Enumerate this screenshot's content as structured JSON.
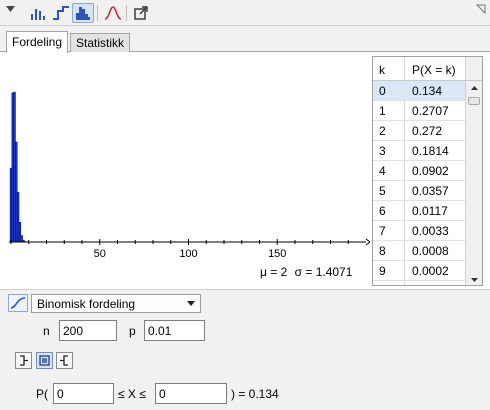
{
  "toolbar": {
    "buttons": [
      {
        "name": "bar-chart-icon"
      },
      {
        "name": "step-graph-icon"
      },
      {
        "name": "histogram-icon",
        "active": true
      },
      {
        "name": "normal-overlay-icon"
      },
      {
        "name": "export-icon"
      }
    ]
  },
  "tabs": [
    {
      "label": "Fordeling",
      "active": true
    },
    {
      "label": "Statistikk",
      "active": false
    }
  ],
  "chart_data": {
    "type": "bar",
    "x": [
      0,
      1,
      2,
      3,
      4,
      5,
      6,
      7,
      8,
      9
    ],
    "values": [
      0.134,
      0.2707,
      0.272,
      0.1814,
      0.0902,
      0.0357,
      0.0117,
      0.0033,
      0.0008,
      0.0002
    ],
    "xlim": [
      0,
      200
    ],
    "xticks": [
      "50",
      "100",
      "150"
    ],
    "ylim": [
      0,
      0.285
    ],
    "color": "#1f3bd1",
    "edge_color": "#0a0a6e",
    "grid": false
  },
  "stats": {
    "mu": "μ = 2",
    "sigma": "σ = 1.4071"
  },
  "table": {
    "headers": [
      "k",
      "P(X = k)"
    ],
    "rows": [
      {
        "k": "0",
        "p": "0.134",
        "selected": true
      },
      {
        "k": "1",
        "p": "0.2707"
      },
      {
        "k": "2",
        "p": "0.272"
      },
      {
        "k": "3",
        "p": "0.1814"
      },
      {
        "k": "4",
        "p": "0.0902"
      },
      {
        "k": "5",
        "p": "0.0357"
      },
      {
        "k": "6",
        "p": "0.0117"
      },
      {
        "k": "7",
        "p": "0.0033"
      },
      {
        "k": "8",
        "p": "0.0008"
      },
      {
        "k": "9",
        "p": "0.0002"
      }
    ]
  },
  "distribution": {
    "selected": "Binomisk fordeling"
  },
  "params": {
    "n_label": "n",
    "n_value": "200",
    "p_label": "p",
    "p_value": "0.01"
  },
  "probability": {
    "open": "P(",
    "low": "0",
    "middle": "≤ X ≤",
    "high": "0",
    "result": ") =  0.134"
  },
  "colors": {
    "bar": "#1f3bd1",
    "accent": "#2b56c2",
    "curve": "#c0304a"
  }
}
